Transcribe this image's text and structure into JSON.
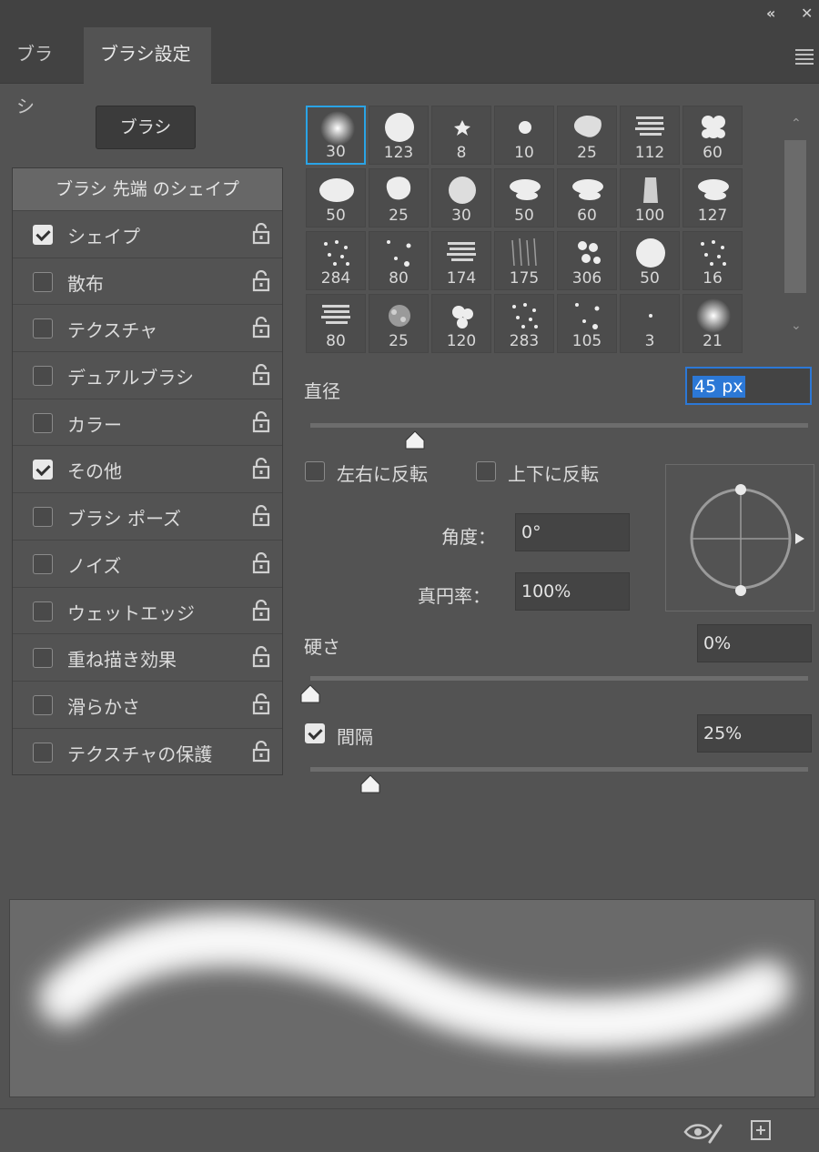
{
  "window": {
    "collapse_icon": "double-chevron-left-icon",
    "close_icon": "close-icon"
  },
  "tabs": [
    {
      "label": "ブラシ"
    },
    {
      "label": "ブラシ設定"
    }
  ],
  "brush_button": {
    "label": "ブラシ"
  },
  "left_panel": {
    "header": "ブラシ 先端 のシェイプ",
    "items": [
      {
        "label": "シェイプ",
        "checked": true
      },
      {
        "label": "散布",
        "checked": false
      },
      {
        "label": "テクスチャ",
        "checked": false
      },
      {
        "label": "デュアルブラシ",
        "checked": false
      },
      {
        "label": "カラー",
        "checked": false
      },
      {
        "label": "その他",
        "checked": true
      },
      {
        "label": "ブラシ ポーズ",
        "checked": false
      },
      {
        "label": "ノイズ",
        "checked": false
      },
      {
        "label": "ウェットエッジ",
        "checked": false
      },
      {
        "label": "重ね描き効果",
        "checked": false
      },
      {
        "label": "滑らかさ",
        "checked": false
      },
      {
        "label": "テクスチャの保護",
        "checked": false
      }
    ]
  },
  "presets": {
    "sizes": [
      [
        "30",
        "123",
        "8",
        "10",
        "25",
        "112",
        "60"
      ],
      [
        "50",
        "25",
        "30",
        "50",
        "60",
        "100",
        "127"
      ],
      [
        "284",
        "80",
        "174",
        "175",
        "306",
        "50",
        "16"
      ],
      [
        "80",
        "25",
        "120",
        "283",
        "105",
        "3",
        "21"
      ]
    ],
    "selected_index": 0
  },
  "diameter": {
    "label": "直径",
    "value": "45 px",
    "level": 0.21
  },
  "flip": {
    "x_label": "左右に反転",
    "y_label": "上下に反転"
  },
  "angle": {
    "label": "角度：",
    "value": "0°"
  },
  "roundness": {
    "label": "真円率：",
    "value": "100%"
  },
  "hardness": {
    "label": "硬さ",
    "value": "0%",
    "level": 0.0
  },
  "spacing": {
    "label": "間隔",
    "value": "25%",
    "checked": true,
    "level": 0.12
  },
  "footer": {
    "toggle_icon": "eye-brush-icon",
    "new_icon": "new-preset-icon"
  },
  "colors": {
    "panel": "#535353",
    "dark": "#424242",
    "accent": "#2aa4e6",
    "focus": "#2c78d6"
  }
}
